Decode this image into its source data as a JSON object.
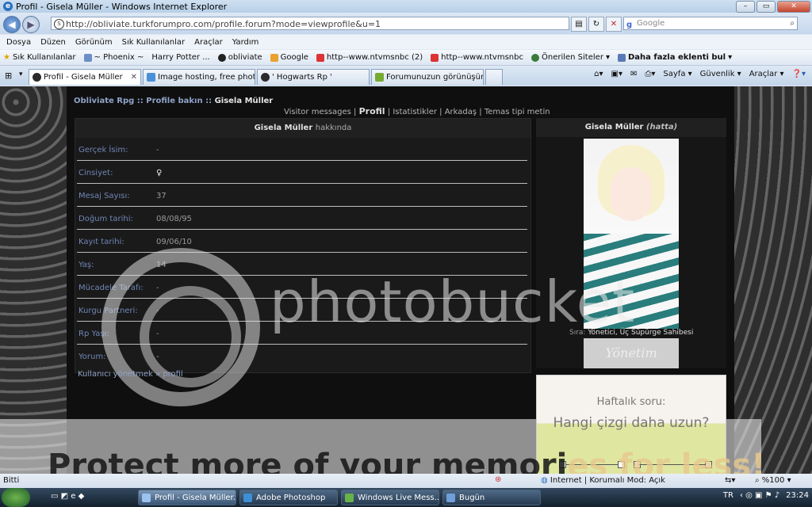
{
  "window": {
    "title": "Profil - Gisela Müller - Windows Internet Explorer"
  },
  "address": {
    "url": "http://obliviate.turkforumpro.com/profile.forum?mode=viewprofile&u=1",
    "search_placeholder": "Google"
  },
  "menu": [
    "Dosya",
    "Düzen",
    "Görünüm",
    "Sık Kullanılanlar",
    "Araçlar",
    "Yardım"
  ],
  "favorites": {
    "label": "Sık Kullanılanlar",
    "items": [
      "~ Phoenix ~",
      "Harry Potter ...",
      "obliviate",
      "Google",
      "http--www.ntvmsnbc (2)",
      "http--www.ntvmsnbc",
      "Önerilen Siteler",
      "Daha fazla eklenti bul"
    ]
  },
  "tabs": [
    "Profil - Gisela Müller",
    "Image hosting, free photo ...",
    "' Hogwarts Rp '",
    "Forumunuzun görünüşün..."
  ],
  "tab_tools": [
    "Sayfa",
    "Güvenlik",
    "Araçlar"
  ],
  "page": {
    "breadcrumb": {
      "site": "Obliviate Rpg",
      "sep1": "::",
      "section": "Profile bakın",
      "sep2": "::",
      "current": "Gisela Müller"
    },
    "subnav": {
      "visitor": "Visitor messages",
      "profil": "Profil",
      "stats": "Istatistikler",
      "friends": "Arkadaş",
      "contact": "Temas tipi metin"
    },
    "about": {
      "name": "Gisela Müller",
      "suffix": "hakkında",
      "fields": [
        {
          "label": "Gerçek İsim:",
          "value": "-"
        },
        {
          "label": "Cinsiyet:",
          "value": "♀"
        },
        {
          "label": "Mesaj Sayısı:",
          "value": "37"
        },
        {
          "label": "Doğum tarihi:",
          "value": "08/08/95"
        },
        {
          "label": "Kayıt tarihi:",
          "value": "09/06/10"
        },
        {
          "label": "Yaş:",
          "value": "14"
        },
        {
          "label": "Mücadele Tarafı:",
          "value": "-"
        },
        {
          "label": "Kurgu Partneri:",
          "value": "-"
        },
        {
          "label": "Rp Yaşı:",
          "value": "-"
        },
        {
          "label": "Yorum:",
          "value": "-"
        }
      ],
      "footer_link": "Kullanıcı yönetmek » profil"
    },
    "side": {
      "name": "Gisela Müller",
      "status": "(hatta)",
      "rank_label": "Sıra:",
      "rank_value": "Yönetici, Üç Süpürge Sahibesi",
      "rank_image_text": "Yönetim"
    },
    "poll": {
      "title": "Haftalık soru:",
      "question": "Hangi çizgi daha uzun?"
    }
  },
  "watermark": {
    "brand": "photobucket",
    "banner_prefix": "Protect more of your memori",
    "banner_suffix": "es for less!"
  },
  "status": {
    "left": "Bitti",
    "zone": "Internet | Korumalı Mod: Açık",
    "zoom": "%100"
  },
  "taskbar": {
    "items": [
      "Profil - Gisela Müller...",
      "Adobe Photoshop",
      "Windows Live Mess...",
      "Bugün"
    ],
    "lang": "TR",
    "time": "23:24"
  }
}
